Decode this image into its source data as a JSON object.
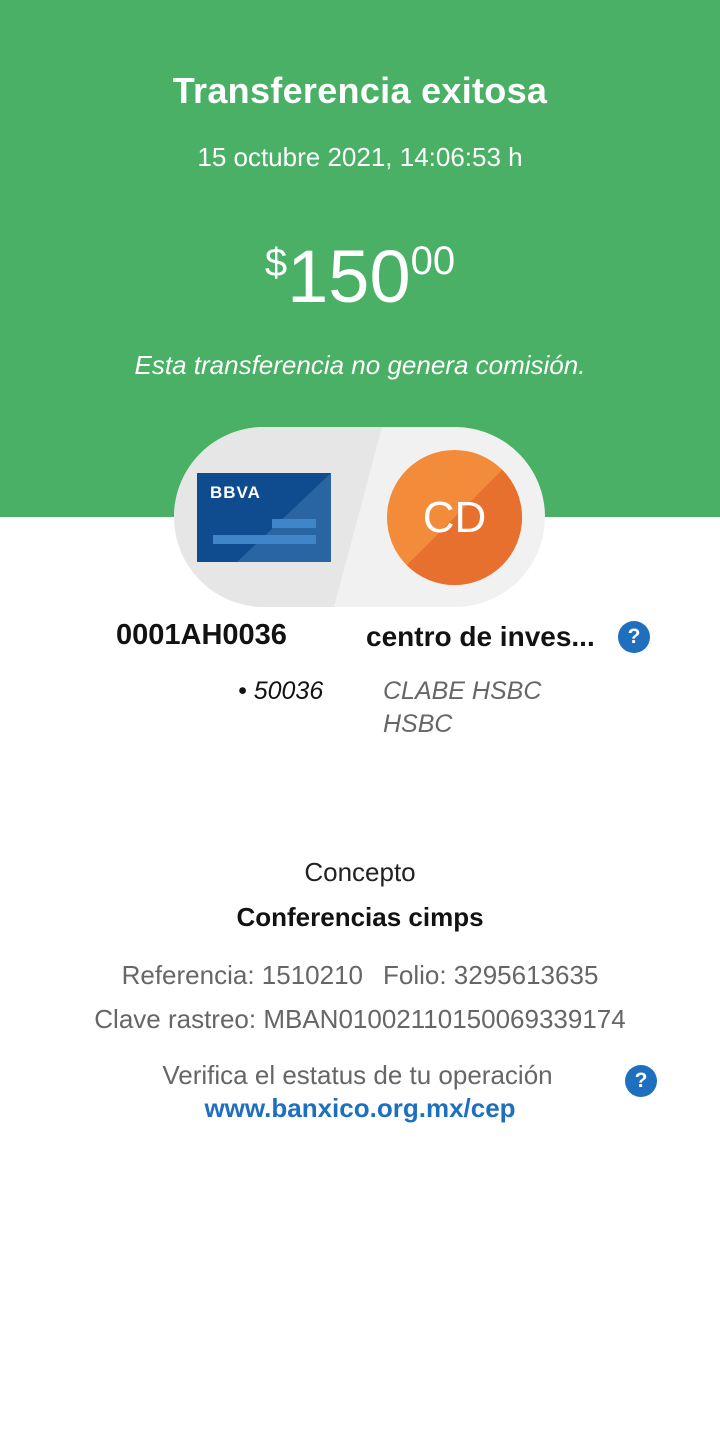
{
  "header": {
    "title": "Transferencia exitosa",
    "datetime": "15 octubre 2021, 14:06:53 h",
    "amount": {
      "currency": "$",
      "integer": "150",
      "cents": "00"
    },
    "commission_note": "Esta transferencia no genera comisión."
  },
  "origin": {
    "card_brand": "BBVA",
    "name": "0001AH0036",
    "account": "• 50036"
  },
  "destination": {
    "initials": "CD",
    "name": "centro de inves...",
    "account_type": "CLABE HSBC",
    "bank": "HSBC",
    "help_icon": "?"
  },
  "details": {
    "concept_label": "Concepto",
    "concept_value": "Conferencias cimps",
    "reference": "Referencia: 1510210",
    "folio": "Folio: 3295613635",
    "trace_key": "Clave rastreo: MBAN01002110150069339174"
  },
  "verify": {
    "text": "Verifica el estatus de tu operación",
    "link": "www.banxico.org.mx/cep",
    "help_icon": "?"
  },
  "colors": {
    "header_green": "#49b065",
    "avatar_orange": "#f28c3a",
    "link_blue": "#1f6fbf",
    "card_blue": "#0f4b8f"
  }
}
